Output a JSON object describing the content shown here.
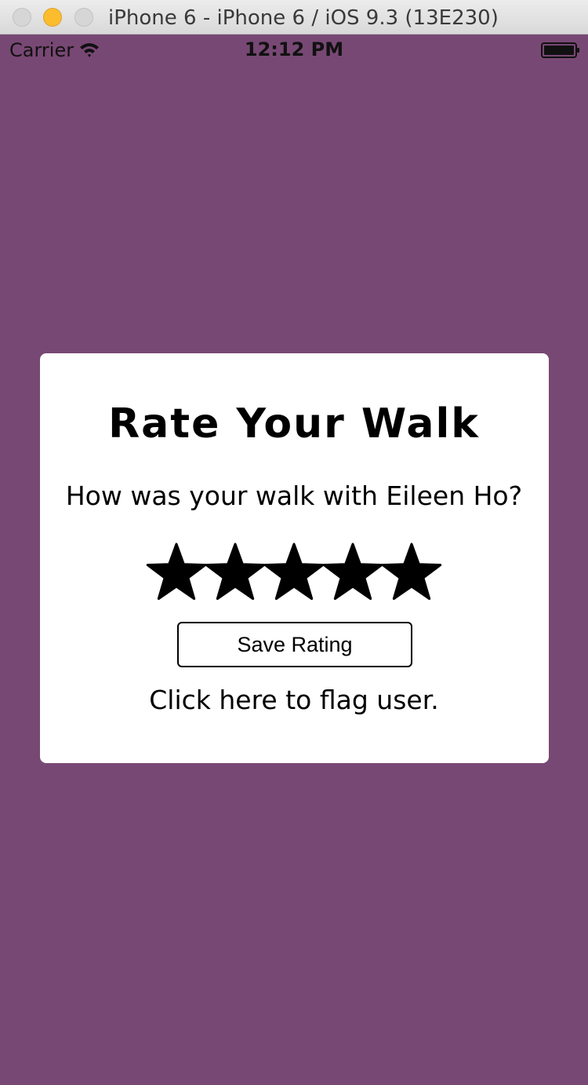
{
  "window": {
    "title": "iPhone 6 - iPhone 6 / iOS 9.3 (13E230)",
    "background_color": "#784874"
  },
  "status_bar": {
    "carrier": "Carrier",
    "time": "12:12 PM",
    "icons": [
      "wifi-icon",
      "battery-icon"
    ]
  },
  "rating_dialog": {
    "title": "Rate Your Walk",
    "question": "How was your walk with Eileen Ho?",
    "rating": 5,
    "max_rating": 5,
    "save_label": "Save Rating",
    "flag_label": "Click here to flag user."
  }
}
